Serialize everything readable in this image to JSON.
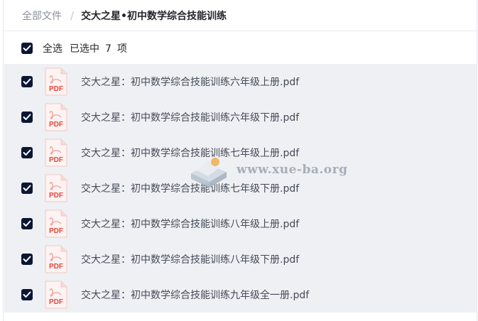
{
  "breadcrumb": {
    "root": "全部文件",
    "separator": "/",
    "current": "交大之星•初中数学综合技能训练"
  },
  "selection": {
    "select_all_label": "全选",
    "selected_prefix": "已选中",
    "selected_count": "7",
    "selected_suffix": "项"
  },
  "files": [
    {
      "name": "交大之星：初中数学综合技能训练六年级上册.pdf",
      "icon": "pdf-icon",
      "icon_label": "PDF",
      "checked": true
    },
    {
      "name": "交大之星：初中数学综合技能训练六年级下册.pdf",
      "icon": "pdf-icon",
      "icon_label": "PDF",
      "checked": true
    },
    {
      "name": "交大之星：初中数学综合技能训练七年级上册.pdf",
      "icon": "pdf-icon",
      "icon_label": "PDF",
      "checked": true
    },
    {
      "name": "交大之星：初中数学综合技能训练七年级下册.pdf",
      "icon": "pdf-icon",
      "icon_label": "PDF",
      "checked": true
    },
    {
      "name": "交大之星：初中数学综合技能训练八年级上册.pdf",
      "icon": "pdf-icon",
      "icon_label": "PDF",
      "checked": true
    },
    {
      "name": "交大之星：初中数学综合技能训练八年级下册.pdf",
      "icon": "pdf-icon",
      "icon_label": "PDF",
      "checked": true
    },
    {
      "name": "交大之星：初中数学综合技能训练九年级全一册.pdf",
      "icon": "pdf-icon",
      "icon_label": "PDF",
      "checked": true
    }
  ],
  "watermark": {
    "text": "www.xue-ba.org"
  },
  "colors": {
    "checkbox": "#0a1733",
    "pdf_red": "#e5483d",
    "row_bg": "#eef0f4"
  }
}
